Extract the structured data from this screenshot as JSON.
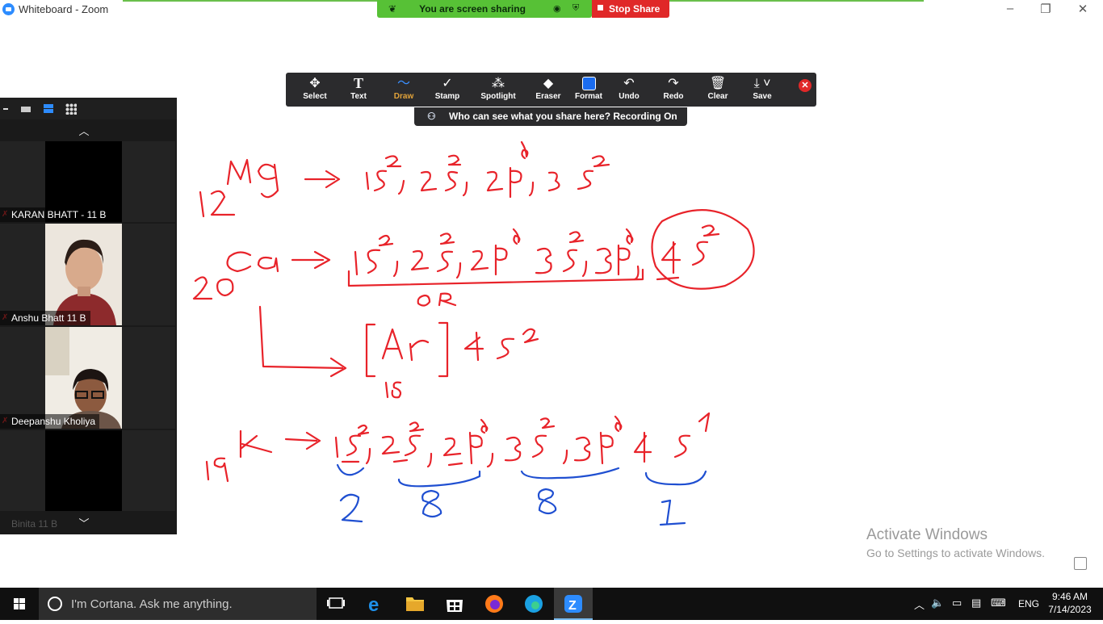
{
  "window": {
    "title": "Whiteboard - Zoom"
  },
  "share_bar": {
    "status": "You are screen sharing",
    "stop_label": "Stop Share"
  },
  "toolbar": {
    "tools": [
      {
        "label": "Select",
        "icon": "move-icon"
      },
      {
        "label": "Text",
        "icon": "text-icon"
      },
      {
        "label": "Draw",
        "icon": "draw-icon",
        "active": true
      },
      {
        "label": "Stamp",
        "icon": "checkmark-icon"
      },
      {
        "label": "Spotlight",
        "icon": "spotlight-icon"
      },
      {
        "label": "Eraser",
        "icon": "eraser-icon"
      },
      {
        "label": "Format",
        "icon": "format-icon"
      },
      {
        "label": "Undo",
        "icon": "undo-icon"
      },
      {
        "label": "Redo",
        "icon": "redo-icon"
      },
      {
        "label": "Clear",
        "icon": "trash-icon"
      },
      {
        "label": "Save",
        "icon": "save-icon"
      }
    ],
    "recording_notice": "Who can see what you share here? Recording On"
  },
  "participants": [
    {
      "name": "KARAN BHATT - 11 B",
      "video": false
    },
    {
      "name": "Anshu Bhatt 11 B",
      "video": true
    },
    {
      "name": "Deepanshu Kholiya",
      "video": true
    }
  ],
  "participant_partial": "Binita 11 B",
  "whiteboard_ink_color": "#e8232a",
  "whiteboard_ink_blue": "#1f4fd1",
  "watermark": {
    "line1": "Activate Windows",
    "line2": "Go to Settings to activate Windows."
  },
  "taskbar": {
    "search_placeholder": "I'm Cortana. Ask me anything.",
    "language": "ENG",
    "time": "9:46 AM",
    "date": "7/14/2023"
  }
}
